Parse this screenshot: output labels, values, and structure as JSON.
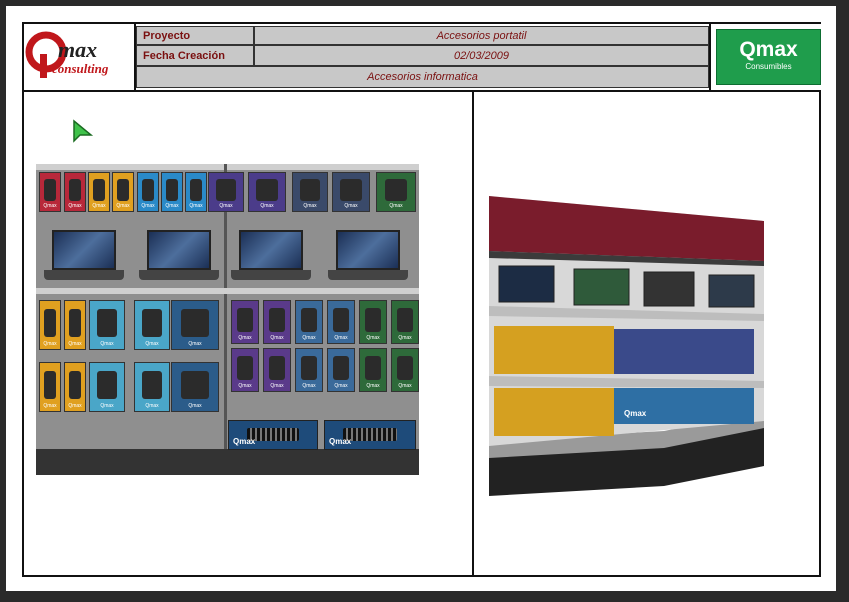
{
  "header": {
    "logo_left": "Qmax consulting",
    "proyecto_label": "Proyecto",
    "proyecto_value": "Accesorios portatil",
    "fecha_label": "Fecha Creación",
    "fecha_value": "02/03/2009",
    "subtitle": "Accesorios informatica",
    "logo_right_title": "Qmax",
    "logo_right_sub": "Consumibles"
  },
  "colors": {
    "header_text": "#7a1010",
    "header_cell": "#c8c8c8",
    "brand_green": "#1f9d4c",
    "frame": "#111111"
  },
  "planogram_brand": "Qmax"
}
